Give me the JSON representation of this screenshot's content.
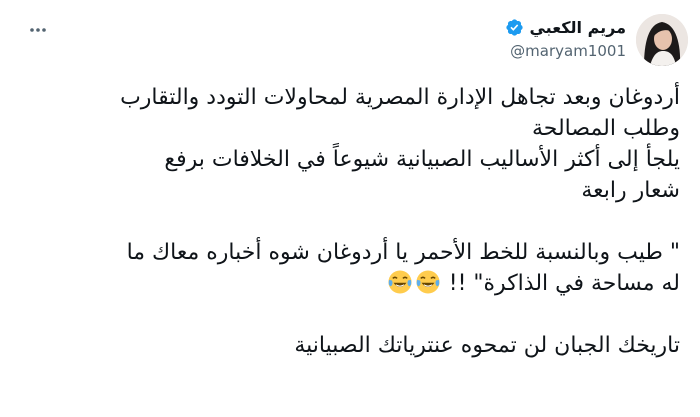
{
  "author": {
    "display_name": "مريم الكعبي",
    "handle": "@maryam1001",
    "verified": true,
    "avatar_icon": "avatar-photo"
  },
  "menu": {
    "more_icon": "more-horizontal-icon"
  },
  "tweet": {
    "lines": [
      "أردوغان وبعد تجاهل الإدارة المصرية لمحاولات التودد والتقارب",
      "وطلب المصالحة",
      "يلجأ إلى أكثر الأساليب الصبيانية شيوعاً في الخلافات برفع",
      "شعار رابعة",
      "\" طيب وبالنسبة للخط الأحمر يا أردوغان شوه أخباره معاك ما",
      "له مساحة في الذاكرة\" !!",
      "تاريخك الجبان لن تمحوه عنترياتك الصبيانية"
    ],
    "emoji": [
      "face-with-tears-of-joy",
      "face-with-tears-of-joy"
    ]
  },
  "colors": {
    "text": "#0f1419",
    "secondary": "#536471",
    "verified": "#1d9bf0"
  }
}
